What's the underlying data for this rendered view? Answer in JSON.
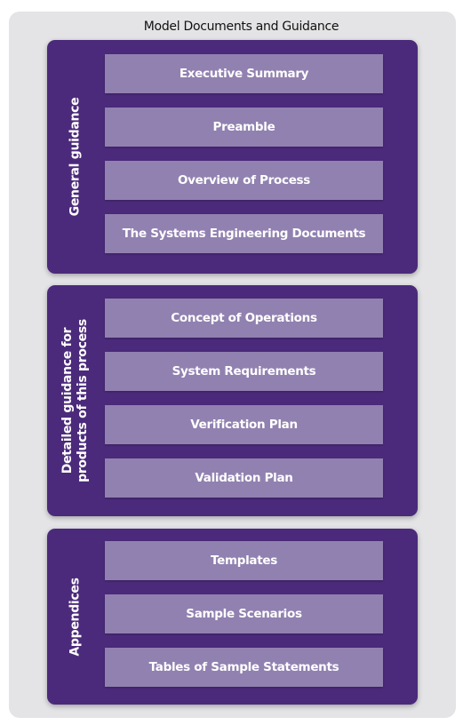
{
  "title": "Model Documents and Guidance",
  "sections": [
    {
      "label": "General guidance",
      "items": [
        "Executive Summary",
        "Preamble",
        "Overview of Process",
        "The Systems Engineering Documents"
      ]
    },
    {
      "label_lines": [
        "Detailed guidance for",
        "products of this process"
      ],
      "items": [
        "Concept of Operations",
        "System Requirements",
        "Verification Plan",
        "Validation Plan"
      ]
    },
    {
      "label": "Appendices",
      "items": [
        "Templates",
        "Sample Scenarios",
        "Tables of Sample Statements"
      ]
    }
  ],
  "colors": {
    "panel": "#4b2a7b",
    "item": "#9181b0",
    "background": "#e4e4e6"
  }
}
